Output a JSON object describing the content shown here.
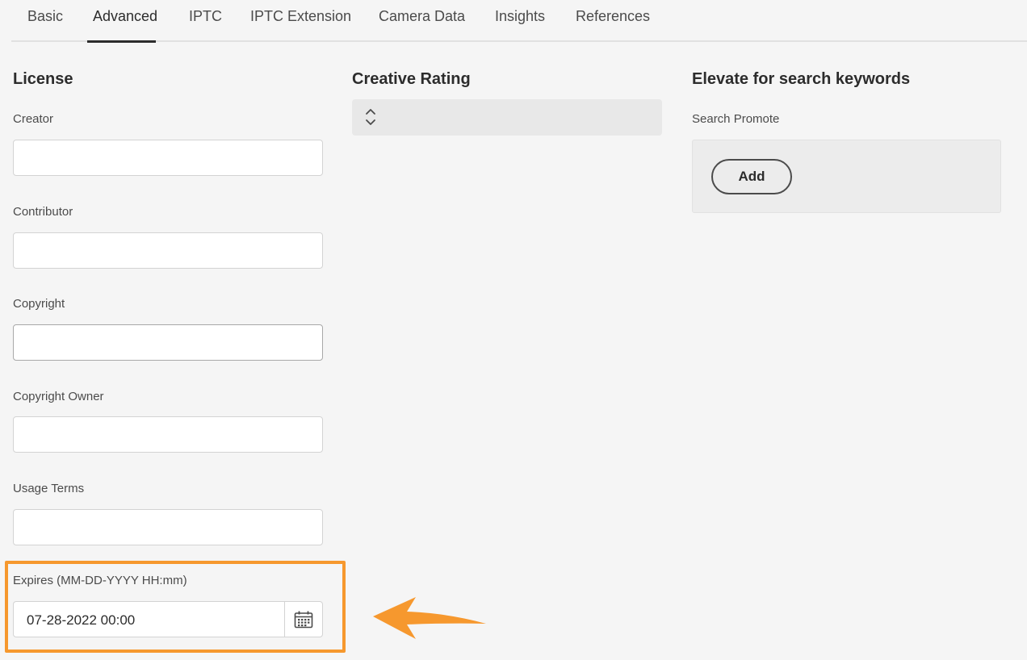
{
  "tabs": [
    {
      "label": "Basic",
      "active": false
    },
    {
      "label": "Advanced",
      "active": true
    },
    {
      "label": "IPTC",
      "active": false
    },
    {
      "label": "IPTC Extension",
      "active": false
    },
    {
      "label": "Camera Data",
      "active": false
    },
    {
      "label": "Insights",
      "active": false
    },
    {
      "label": "References",
      "active": false
    }
  ],
  "license": {
    "title": "License",
    "fields": {
      "creator": {
        "label": "Creator",
        "value": ""
      },
      "contributor": {
        "label": "Contributor",
        "value": ""
      },
      "copyright": {
        "label": "Copyright",
        "value": ""
      },
      "copyright_owner": {
        "label": "Copyright Owner",
        "value": ""
      },
      "usage_terms": {
        "label": "Usage Terms",
        "value": ""
      },
      "expires": {
        "label": "Expires (MM-DD-YYYY HH:mm)",
        "value": "07-28-2022 00:00",
        "icon": "calendar-icon"
      }
    }
  },
  "creative_rating": {
    "title": "Creative Rating",
    "value": "",
    "icon": "chevron-up-down-icon"
  },
  "search_keywords": {
    "title": "Elevate for search keywords",
    "promote_label": "Search Promote",
    "add_label": "Add"
  },
  "annotation": {
    "highlight_color": "#f6982e",
    "arrow_color": "#f6982e"
  },
  "colors": {
    "background": "#f5f5f5",
    "text": "#2c2c2c",
    "muted_text": "#4b4b4b",
    "input_border": "#d3d3d3"
  }
}
